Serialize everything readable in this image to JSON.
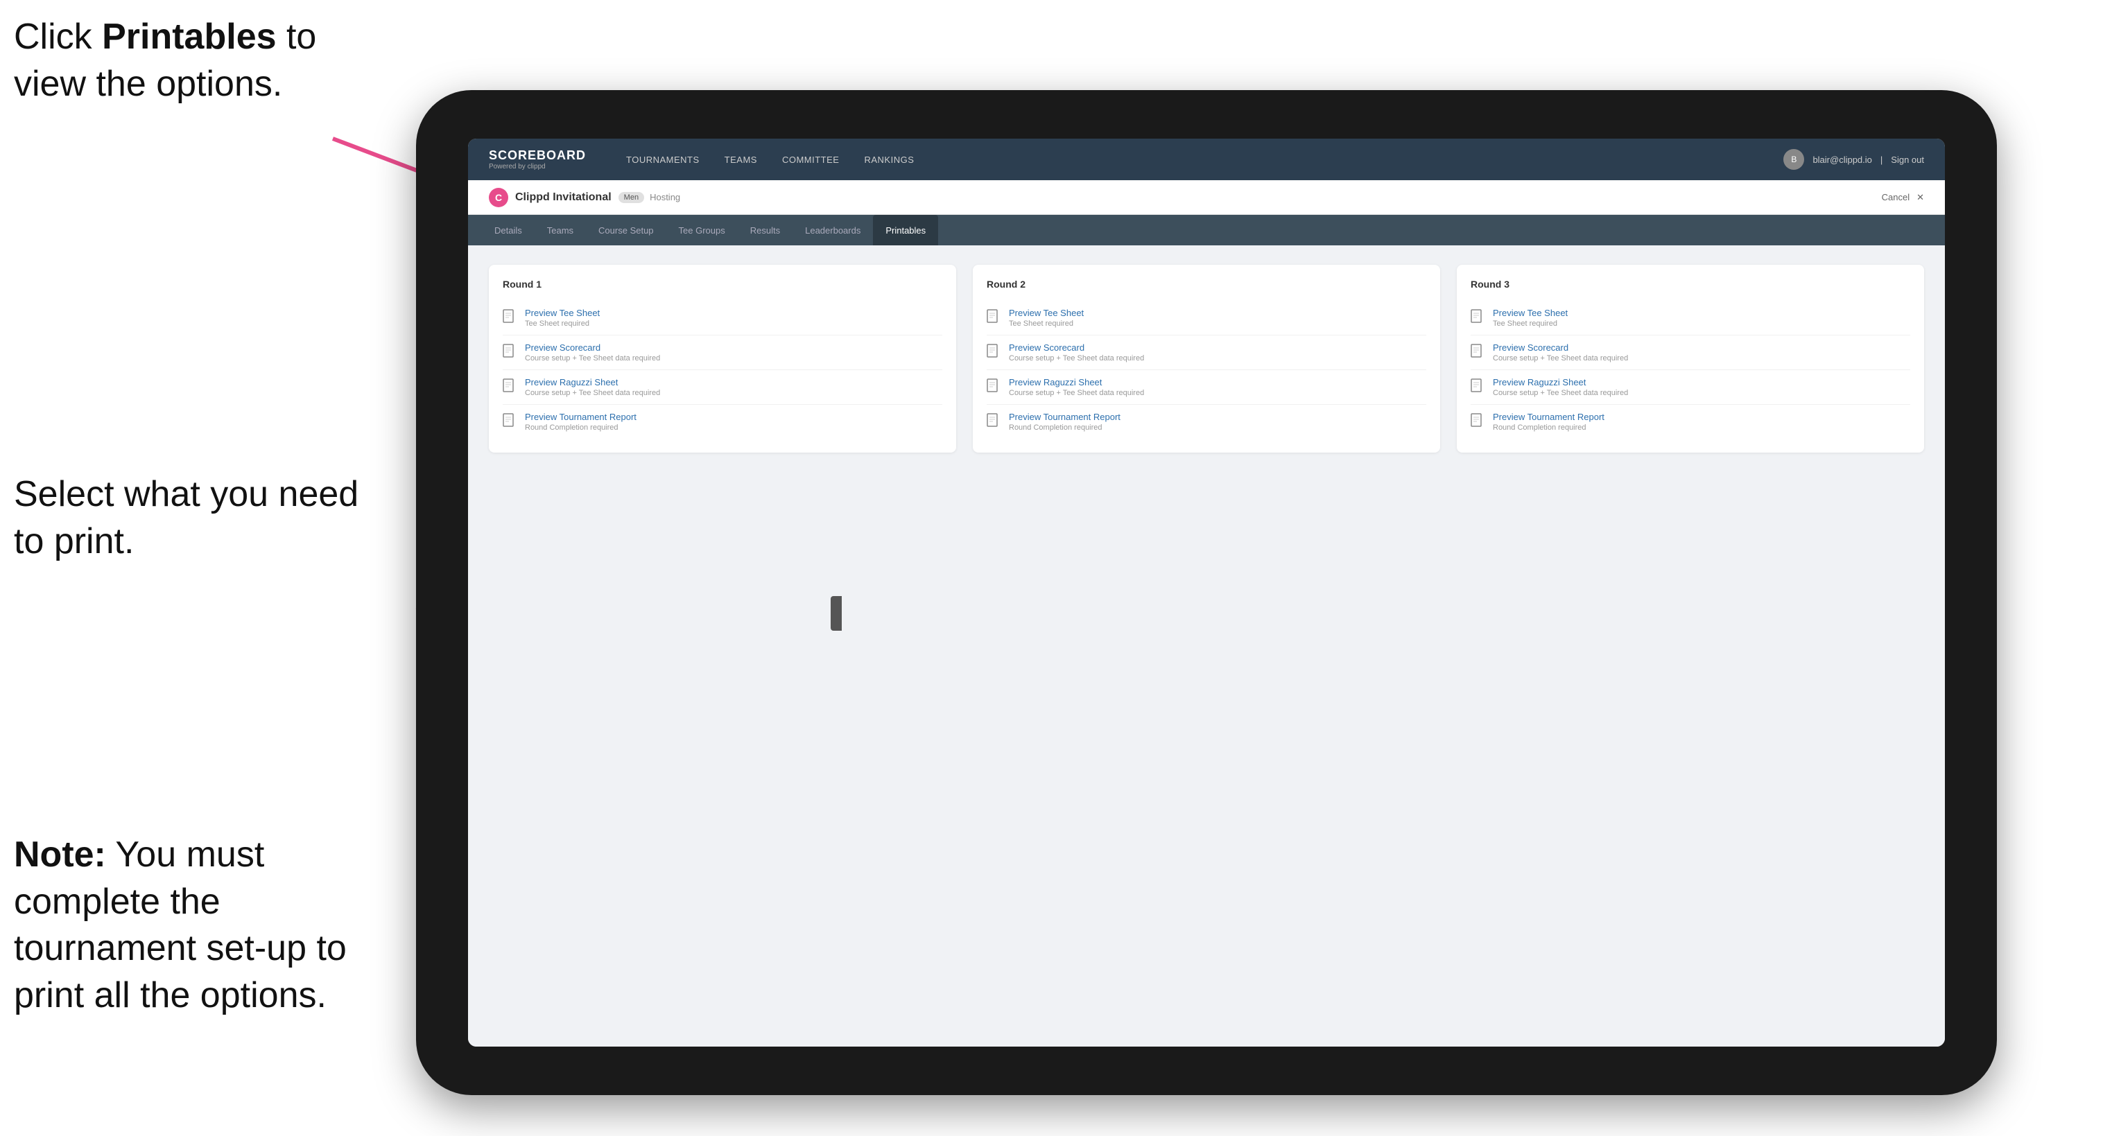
{
  "annotations": {
    "top": {
      "line1": "Click ",
      "bold": "Printables",
      "line1_end": " to",
      "line2": "view the options."
    },
    "middle": {
      "line1": "Select what you",
      "line2": "need to print."
    },
    "bottom": {
      "bold": "Note:",
      "rest": " You must complete the tournament set-up to print all the options."
    }
  },
  "nav": {
    "brand": "SCOREBOARD",
    "brand_sub": "Powered by clippd",
    "links": [
      "TOURNAMENTS",
      "TEAMS",
      "COMMITTEE",
      "RANKINGS"
    ],
    "user_email": "blair@clippd.io",
    "sign_out": "Sign out"
  },
  "sub_header": {
    "logo_letter": "C",
    "tournament_name": "Clippd Invitational",
    "badge": "Men",
    "status": "Hosting",
    "cancel": "Cancel"
  },
  "tabs": [
    "Details",
    "Teams",
    "Course Setup",
    "Tee Groups",
    "Results",
    "Leaderboards",
    "Printables"
  ],
  "active_tab": "Printables",
  "rounds": [
    {
      "title": "Round 1",
      "items": [
        {
          "title": "Preview Tee Sheet",
          "subtitle": "Tee Sheet required"
        },
        {
          "title": "Preview Scorecard",
          "subtitle": "Course setup + Tee Sheet data required"
        },
        {
          "title": "Preview Raguzzi Sheet",
          "subtitle": "Course setup + Tee Sheet data required"
        },
        {
          "title": "Preview Tournament Report",
          "subtitle": "Round Completion required"
        }
      ]
    },
    {
      "title": "Round 2",
      "items": [
        {
          "title": "Preview Tee Sheet",
          "subtitle": "Tee Sheet required"
        },
        {
          "title": "Preview Scorecard",
          "subtitle": "Course setup + Tee Sheet data required"
        },
        {
          "title": "Preview Raguzzi Sheet",
          "subtitle": "Course setup + Tee Sheet data required"
        },
        {
          "title": "Preview Tournament Report",
          "subtitle": "Round Completion required"
        }
      ]
    },
    {
      "title": "Round 3",
      "items": [
        {
          "title": "Preview Tee Sheet",
          "subtitle": "Tee Sheet required"
        },
        {
          "title": "Preview Scorecard",
          "subtitle": "Course setup + Tee Sheet data required"
        },
        {
          "title": "Preview Raguzzi Sheet",
          "subtitle": "Course setup + Tee Sheet data required"
        },
        {
          "title": "Preview Tournament Report",
          "subtitle": "Round Completion required"
        }
      ]
    }
  ],
  "colors": {
    "accent": "#e74c8b",
    "nav_bg": "#2c3e50",
    "tab_bg": "#3d4f5c",
    "link_color": "#2c6fad"
  }
}
